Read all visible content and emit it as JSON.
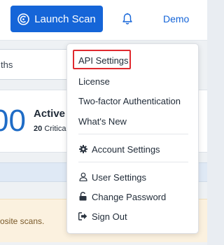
{
  "header": {
    "launch_scan_label": "Launch Scan",
    "user_menu_label": "Demo"
  },
  "background": {
    "search_fragment": "ths",
    "big_number_fragment": "00",
    "active_label_fragment": "Active I",
    "critical_count": "20",
    "critical_label_fragment": "Critica",
    "notice_fragment": "osite scans."
  },
  "dropdown": {
    "items": [
      {
        "label": "API Settings",
        "icon": null,
        "highlighted": true
      },
      {
        "label": "License",
        "icon": null
      },
      {
        "label": "Two-factor Authentication",
        "icon": null
      },
      {
        "label": "What's New",
        "icon": null
      },
      {
        "label": "Account Settings",
        "icon": "gear-icon"
      },
      {
        "label": "User Settings",
        "icon": "user-icon"
      },
      {
        "label": "Change Password",
        "icon": "lock-icon"
      },
      {
        "label": "Sign Out",
        "icon": "sign-out-icon"
      }
    ]
  },
  "colors": {
    "brand_blue": "#1565d8",
    "highlight_red": "#e0292f",
    "big_number_blue": "#1f6cc6"
  }
}
